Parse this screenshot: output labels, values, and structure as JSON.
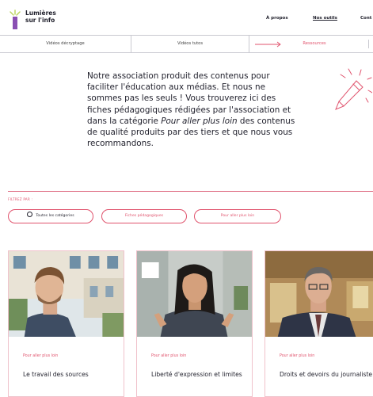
{
  "header": {
    "logo_line1": "Lumières",
    "logo_line2": "sur l'info",
    "nav": [
      {
        "label": "À propos"
      },
      {
        "label": "Nos outils"
      },
      {
        "label": "Cont"
      }
    ]
  },
  "subnav": {
    "items": [
      {
        "label": "Vidéos décryptage"
      },
      {
        "label": "Vidéos tutos"
      },
      {
        "label": "Ressources"
      }
    ]
  },
  "intro": {
    "text_before": "Notre association produit des contenus pour faciliter l'éducation aux médias. Et nous ne sommes pas les seuls ! Vous trouverez ici des fiches pédagogiques rédigées par l'association et dans la catégorie ",
    "text_em": "Pour aller plus loin",
    "text_after": " des contenus de qualité produits par des tiers et que nous vous recommandons."
  },
  "filters": {
    "label": "FILTREZ PAR :",
    "pills": [
      {
        "label": "Toutes les catégories"
      },
      {
        "label": "Fiches pédagogiques"
      },
      {
        "label": "Pour aller plus loin"
      }
    ]
  },
  "cards": [
    {
      "category": "Pour aller plus loin",
      "title": "Le travail des sources"
    },
    {
      "category": "Pour aller plus loin",
      "title": "Liberté d'expression et limites"
    },
    {
      "category": "Pour aller plus loin",
      "title": "Droits et devoirs du journaliste"
    }
  ],
  "colors": {
    "accent": "#e0536d",
    "text": "#1f1f2b",
    "logo_purple": "#8a4fb3",
    "logo_green": "#b9d35a"
  },
  "icons": [
    "logo-mark-icon",
    "arrow-right-icon",
    "pencil-icon",
    "radio-icon"
  ]
}
